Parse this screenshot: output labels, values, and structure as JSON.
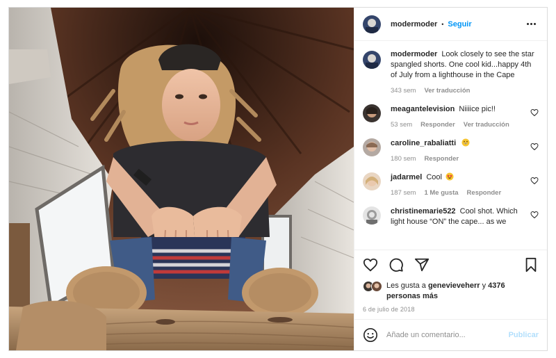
{
  "header": {
    "username": "modermoder",
    "separator": "•",
    "follow_label": "Seguir",
    "more_icon": "more-horizontal-icon"
  },
  "caption": {
    "username": "modermoder",
    "text": "Look closely to see the star spangled shorts. One cool kid...happy 4th of July from a lighthouse in the Cape",
    "age": "343 sem",
    "translate_label": "Ver traducción"
  },
  "comments": [
    {
      "username": "meagantelevision",
      "text": "Niiiice pic!!",
      "emoji": "",
      "age": "53 sem",
      "reply_label": "Responder",
      "likes_label": "",
      "translate_label": "Ver traducción"
    },
    {
      "username": "caroline_rabaliatti",
      "text": "",
      "emoji": "grinning-face-emoji",
      "age": "180 sem",
      "reply_label": "Responder",
      "likes_label": "",
      "translate_label": ""
    },
    {
      "username": "jadarmel",
      "text": "Cool",
      "emoji": "star-struck-emoji",
      "age": "187 sem",
      "reply_label": "Responder",
      "likes_label": "1 Me gusta",
      "translate_label": ""
    },
    {
      "username": "christinemarie522",
      "text": "Cool shot. Which light house “ON” the cape... as we",
      "emoji": "",
      "age": "",
      "reply_label": "",
      "likes_label": "",
      "translate_label": ""
    }
  ],
  "actions": {
    "like_icon": "heart-icon",
    "comment_icon": "comment-icon",
    "share_icon": "share-icon",
    "save_icon": "bookmark-icon"
  },
  "likes": {
    "prefix": "Les gusta a",
    "user": "genevieveherr",
    "conjunction": "y",
    "others": "4376 personas más"
  },
  "date": "6 de julio de 2018",
  "add_comment": {
    "emoji_icon": "smiley-icon",
    "placeholder": "Añade un comentario...",
    "publish_label": "Publicar"
  },
  "colors": {
    "accent": "#0095f6",
    "publish_disabled": "#b2dffc",
    "muted_text": "#8e8e8e",
    "border": "#dbdbdb"
  }
}
